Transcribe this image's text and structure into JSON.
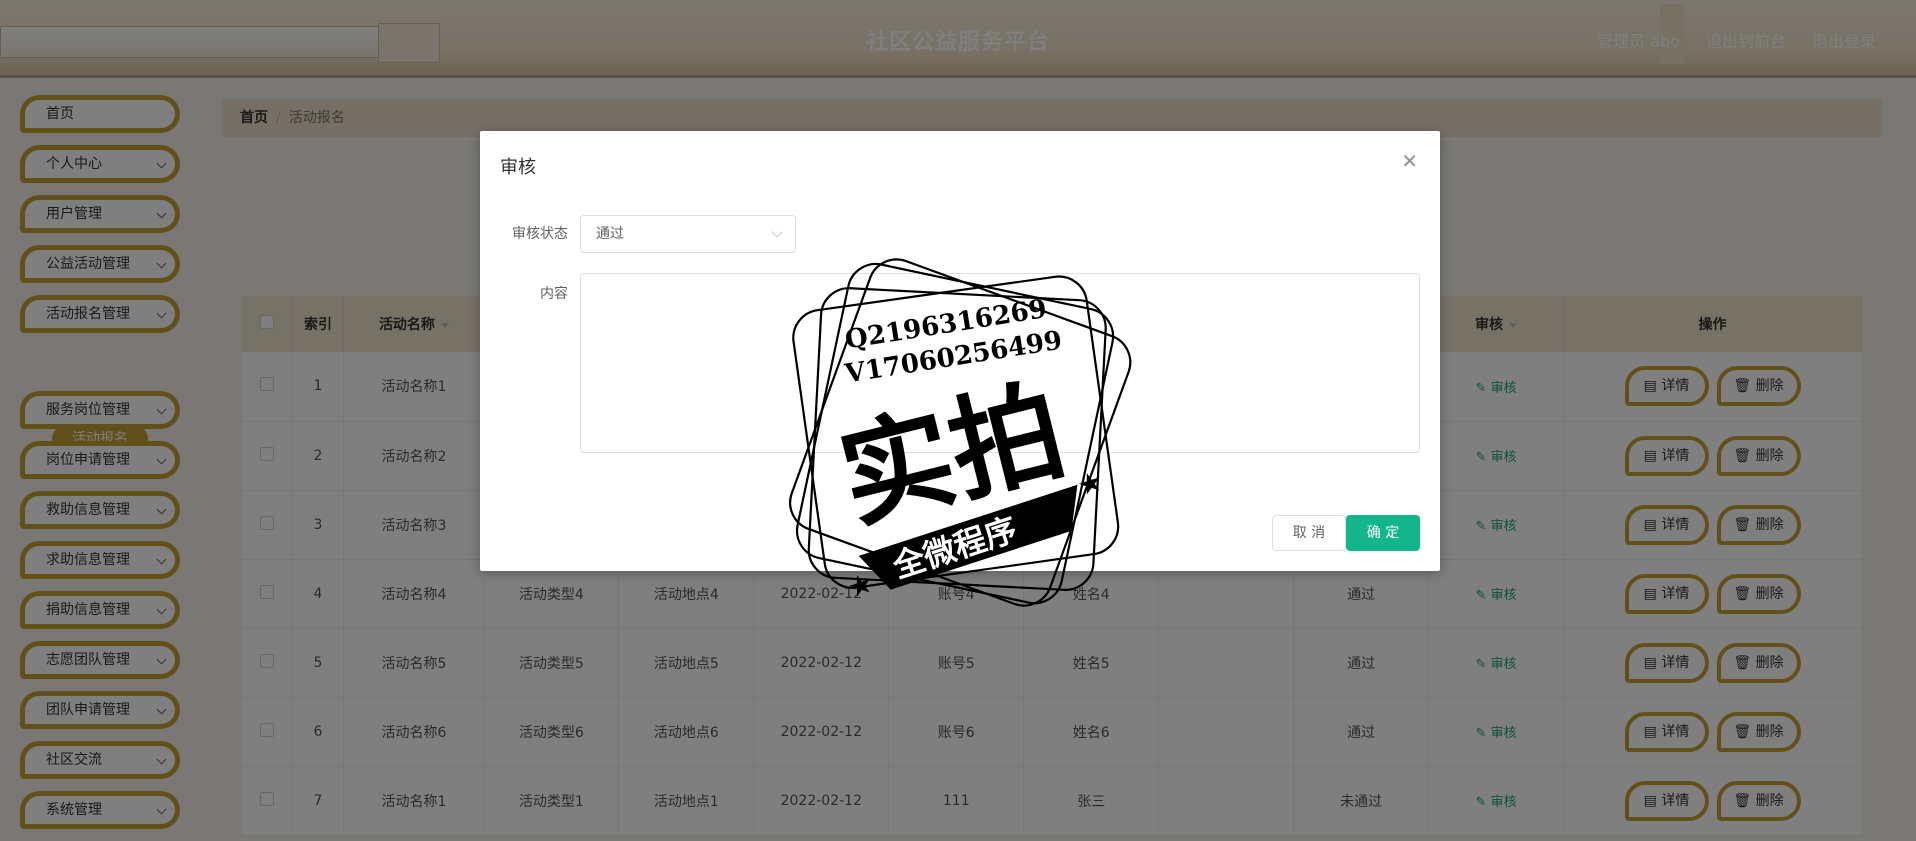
{
  "header": {
    "title": "社区公益服务平台",
    "admin_label": "管理员 abo",
    "goto_front": "退出到前台",
    "logout": "退出登录"
  },
  "sidebar": {
    "items": [
      {
        "label": "首页",
        "has_chevron": false
      },
      {
        "label": "个人中心",
        "has_chevron": true
      },
      {
        "label": "用户管理",
        "has_chevron": true
      },
      {
        "label": "公益活动管理",
        "has_chevron": true
      },
      {
        "label": "活动报名管理",
        "has_chevron": true
      },
      {
        "label": "服务岗位管理",
        "has_chevron": true
      },
      {
        "label": "岗位申请管理",
        "has_chevron": true
      },
      {
        "label": "救助信息管理",
        "has_chevron": true
      },
      {
        "label": "求助信息管理",
        "has_chevron": true
      },
      {
        "label": "捐助信息管理",
        "has_chevron": true
      },
      {
        "label": "志愿团队管理",
        "has_chevron": true
      },
      {
        "label": "团队申请管理",
        "has_chevron": true
      },
      {
        "label": "社区交流",
        "has_chevron": true
      },
      {
        "label": "系统管理",
        "has_chevron": true
      }
    ],
    "active_sub": "活动报名"
  },
  "breadcrumb": {
    "home": "首页",
    "sep": "/",
    "current": "活动报名"
  },
  "table": {
    "headers": {
      "index": "索引",
      "name": "活动名称",
      "audit": "审核",
      "actions": "操作"
    },
    "audit_link": "审核",
    "detail_btn": "详情",
    "delete_btn": "删除",
    "rows": [
      {
        "index": "1",
        "name": "活动名称1",
        "type": "",
        "place": "",
        "date": "",
        "account": "",
        "person": "",
        "status": ""
      },
      {
        "index": "2",
        "name": "活动名称2",
        "type": "",
        "place": "",
        "date": "",
        "account": "",
        "person": "",
        "status": ""
      },
      {
        "index": "3",
        "name": "活动名称3",
        "type": "",
        "place": "",
        "date": "",
        "account": "",
        "person": "",
        "status": ""
      },
      {
        "index": "4",
        "name": "活动名称4",
        "type": "活动类型4",
        "place": "活动地点4",
        "date": "2022-02-12",
        "account": "账号4",
        "person": "姓名4",
        "status": "通过"
      },
      {
        "index": "5",
        "name": "活动名称5",
        "type": "活动类型5",
        "place": "活动地点5",
        "date": "2022-02-12",
        "account": "账号5",
        "person": "姓名5",
        "status": "通过"
      },
      {
        "index": "6",
        "name": "活动名称6",
        "type": "活动类型6",
        "place": "活动地点6",
        "date": "2022-02-12",
        "account": "账号6",
        "person": "姓名6",
        "status": "通过"
      },
      {
        "index": "7",
        "name": "活动名称1",
        "type": "活动类型1",
        "place": "活动地点1",
        "date": "2022-02-12",
        "account": "111",
        "person": "张三",
        "status": "未通过"
      }
    ]
  },
  "dialog": {
    "title": "审核",
    "status_label": "审核状态",
    "status_value": "通过",
    "content_label": "内容",
    "content_value": "",
    "cancel": "取 消",
    "confirm": "确 定"
  },
  "watermark": {
    "line1": "Q2196316269",
    "line2": "V17060256499",
    "main": "实拍",
    "ribbon": "全微程序"
  },
  "colors": {
    "accent": "#c5a034",
    "confirm": "#13b58a",
    "link": "#1aa37a"
  }
}
